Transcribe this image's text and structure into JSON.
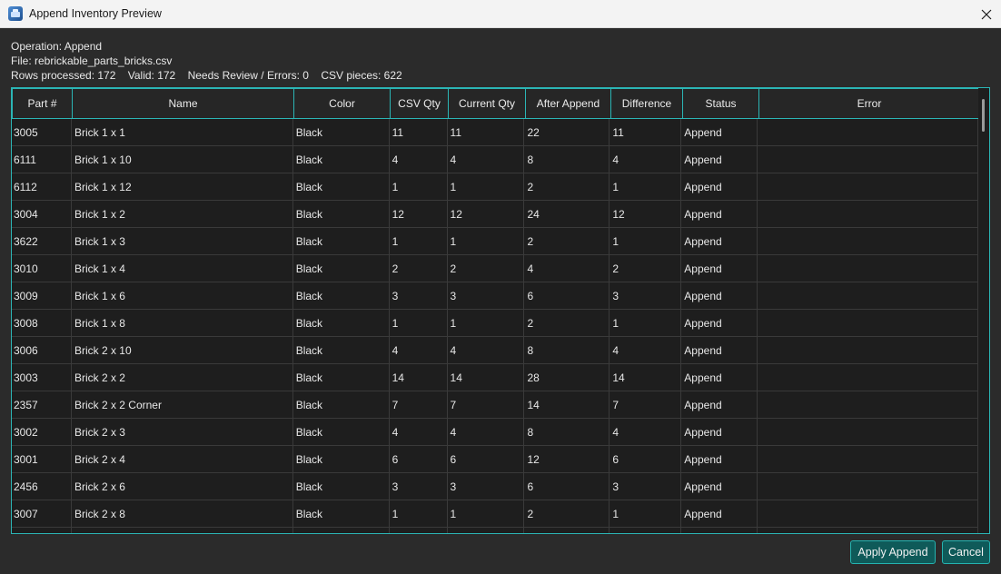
{
  "window": {
    "title": "Append Inventory Preview",
    "icons": {
      "app": "app-icon",
      "close": "close-icon"
    }
  },
  "info": {
    "operation": "Operation: Append",
    "file": "File: rebrickable_parts_bricks.csv",
    "rows_processed": "Rows processed: 172",
    "valid": "Valid: 172",
    "needs_review": "Needs Review / Errors: 0",
    "csv_pieces": "CSV pieces: 622"
  },
  "table": {
    "columns": [
      "Part #",
      "Name",
      "Color",
      "CSV Qty",
      "Current Qty",
      "After Append",
      "Difference",
      "Status",
      "Error"
    ],
    "rows": [
      [
        "3005",
        "Brick 1 x 1",
        "Black",
        "11",
        "11",
        "22",
        "11",
        "Append",
        ""
      ],
      [
        "6111",
        "Brick 1 x 10",
        "Black",
        "4",
        "4",
        "8",
        "4",
        "Append",
        ""
      ],
      [
        "6112",
        "Brick 1 x 12",
        "Black",
        "1",
        "1",
        "2",
        "1",
        "Append",
        ""
      ],
      [
        "3004",
        "Brick 1 x 2",
        "Black",
        "12",
        "12",
        "24",
        "12",
        "Append",
        ""
      ],
      [
        "3622",
        "Brick 1 x 3",
        "Black",
        "1",
        "1",
        "2",
        "1",
        "Append",
        ""
      ],
      [
        "3010",
        "Brick 1 x 4",
        "Black",
        "2",
        "2",
        "4",
        "2",
        "Append",
        ""
      ],
      [
        "3009",
        "Brick 1 x 6",
        "Black",
        "3",
        "3",
        "6",
        "3",
        "Append",
        ""
      ],
      [
        "3008",
        "Brick 1 x 8",
        "Black",
        "1",
        "1",
        "2",
        "1",
        "Append",
        ""
      ],
      [
        "3006",
        "Brick 2 x 10",
        "Black",
        "4",
        "4",
        "8",
        "4",
        "Append",
        ""
      ],
      [
        "3003",
        "Brick 2 x 2",
        "Black",
        "14",
        "14",
        "28",
        "14",
        "Append",
        ""
      ],
      [
        "2357",
        "Brick 2 x 2 Corner",
        "Black",
        "7",
        "7",
        "14",
        "7",
        "Append",
        ""
      ],
      [
        "3002",
        "Brick 2 x 3",
        "Black",
        "4",
        "4",
        "8",
        "4",
        "Append",
        ""
      ],
      [
        "3001",
        "Brick 2 x 4",
        "Black",
        "6",
        "6",
        "12",
        "6",
        "Append",
        ""
      ],
      [
        "2456",
        "Brick 2 x 6",
        "Black",
        "3",
        "3",
        "6",
        "3",
        "Append",
        ""
      ],
      [
        "3007",
        "Brick 2 x 8",
        "Black",
        "1",
        "1",
        "2",
        "1",
        "Append",
        ""
      ],
      [
        "",
        "",
        "",
        "",
        "",
        "",
        "",
        "",
        ""
      ]
    ]
  },
  "buttons": {
    "apply": "Apply Append",
    "cancel": "Cancel"
  },
  "colors": {
    "accent": "#2bb5b5",
    "button_bg": "#0f5a59",
    "background": "#2b2b2b",
    "table_bg": "#1e1e1e"
  }
}
